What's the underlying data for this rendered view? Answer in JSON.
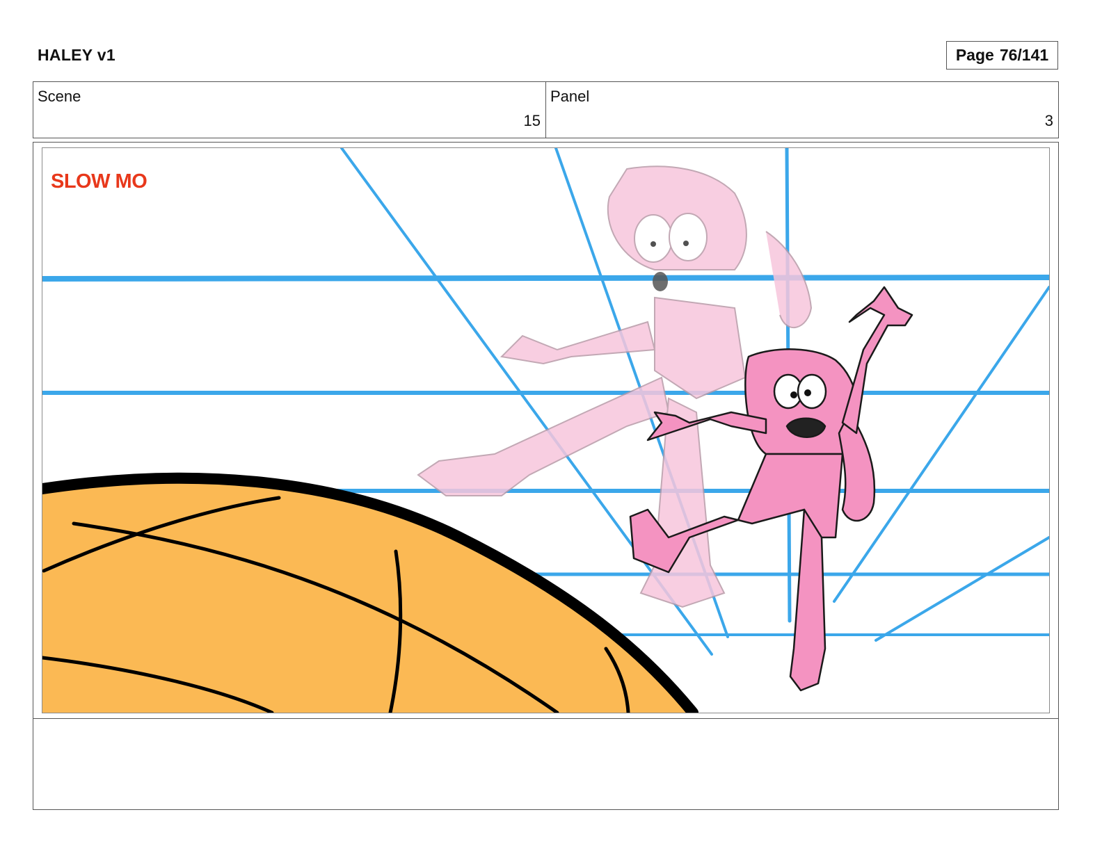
{
  "header": {
    "title": "HALEY v1",
    "page_label": "Page",
    "page_value": "76/141"
  },
  "meta": {
    "scene_label": "Scene",
    "scene_value": "15",
    "panel_label": "Panel",
    "panel_value": "3"
  },
  "panel_art": {
    "overlay_text": "SLOW MO",
    "overlay_color": "#e8381b",
    "guide_color": "#3ba7ea",
    "ball_color": "#fbb954",
    "sketch_color": "#f7c6dc",
    "character_color": "#f493c1"
  },
  "notes": {
    "text": ""
  }
}
